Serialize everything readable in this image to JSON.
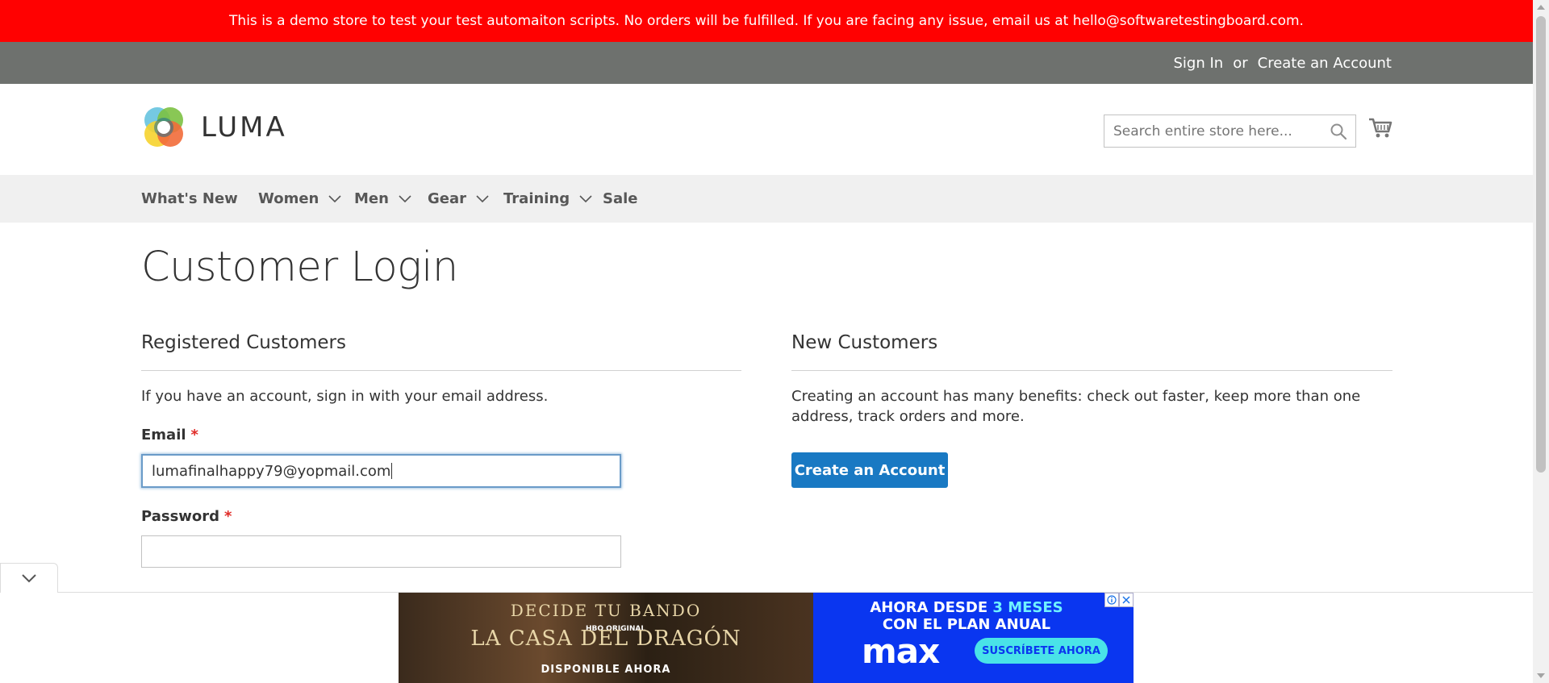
{
  "demo_notice": "This is a demo store to test your test automaiton scripts. No orders will be fulfilled. If you are facing any issue, email us at hello@softwaretestingboard.com.",
  "top_links": {
    "sign_in": "Sign In",
    "or": "or",
    "create_account": "Create an Account"
  },
  "header": {
    "logo_text": "LUMA",
    "search_placeholder": "Search entire store here..."
  },
  "nav": {
    "items": [
      {
        "label": "What's New",
        "has_dropdown": false
      },
      {
        "label": "Women",
        "has_dropdown": true
      },
      {
        "label": "Men",
        "has_dropdown": true
      },
      {
        "label": "Gear",
        "has_dropdown": true
      },
      {
        "label": "Training",
        "has_dropdown": true
      },
      {
        "label": "Sale",
        "has_dropdown": false
      }
    ]
  },
  "page_title": "Customer Login",
  "registered": {
    "title": "Registered Customers",
    "note": "If you have an account, sign in with your email address.",
    "email_label": "Email",
    "email_value": "lumafinalhappy79@yopmail.com",
    "password_label": "Password",
    "password_value": "",
    "required_mark": "*"
  },
  "new_customers": {
    "title": "New Customers",
    "note": "Creating an account has many benefits: check out faster, keep more than one address, track orders and more.",
    "button": "Create an Account"
  },
  "ad": {
    "left_line1": "DECIDE TU BANDO",
    "left_brand": "HBO ORIGINAL",
    "left_title": "LA CASA DEL DRAGÓN",
    "left_line3": "DISPONIBLE AHORA",
    "right_line1_prefix": "AHORA DESDE",
    "right_line1_highlight": "3 MESES",
    "right_line2": "CON EL PLAN ANUAL",
    "right_brand": "max",
    "right_cta": "SUSCRÍBETE AHORA"
  },
  "colors": {
    "demo_bar": "#ff0101",
    "top_bar": "#6e716e",
    "nav_bg": "#f0f0f0",
    "primary_button": "#1979c3",
    "required": "#e02b27"
  }
}
